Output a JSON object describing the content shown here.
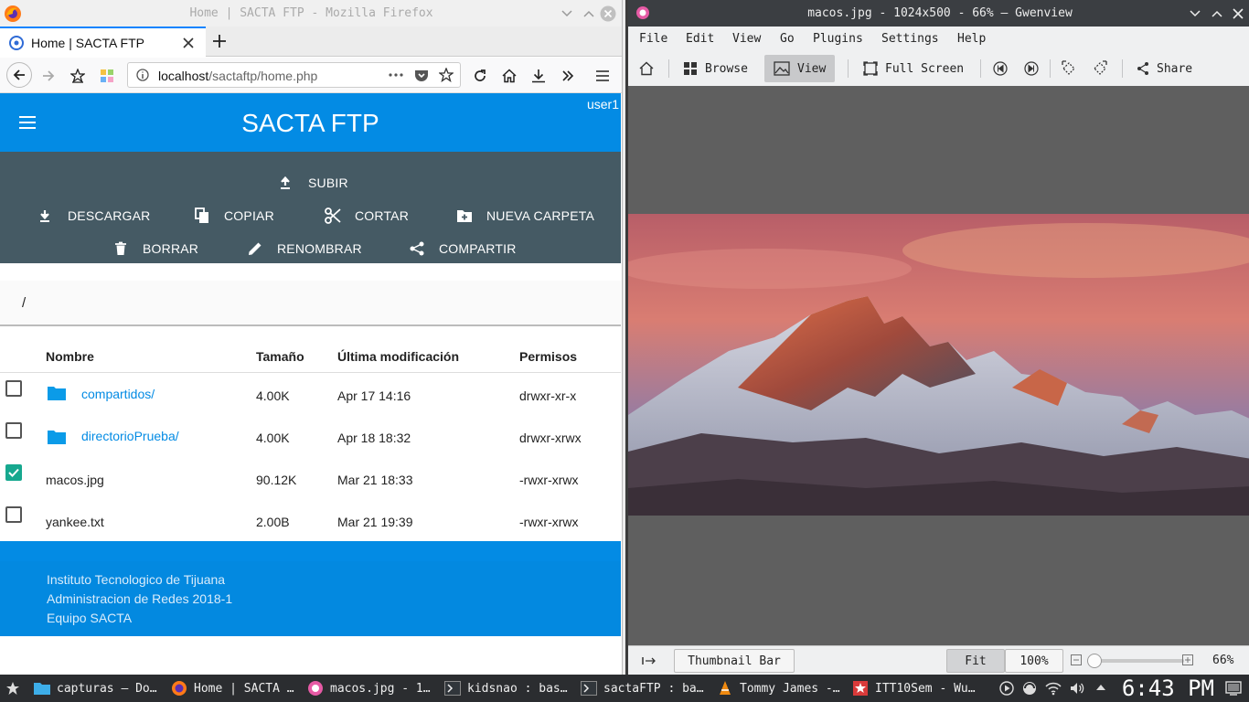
{
  "firefox": {
    "window_title": "Home | SACTA FTP - Mozilla Firefox",
    "tab_title": "Home | SACTA FTP",
    "url_host": "localhost",
    "url_path": "/sactaftp/home.php"
  },
  "app": {
    "title": "SACTA FTP",
    "user": "user1",
    "actions": {
      "upload": "SUBIR",
      "download": "DESCARGAR",
      "copy": "COPIAR",
      "cut": "CORTAR",
      "new_folder": "NUEVA CARPETA",
      "delete": "BORRAR",
      "rename": "RENOMBRAR",
      "share": "COMPARTIR"
    },
    "path": "/",
    "table": {
      "headers": {
        "name": "Nombre",
        "size": "Tamaño",
        "modified": "Última modificación",
        "permissions": "Permisos"
      },
      "rows": [
        {
          "name": "compartidos/",
          "size": "4.00K",
          "modified": "Apr 17 14:16",
          "perms": "drwxr-xr-x",
          "checked": false,
          "folder": true
        },
        {
          "name": "directorioPrueba/",
          "size": "4.00K",
          "modified": "Apr 18 18:32",
          "perms": "drwxr-xrwx",
          "checked": false,
          "folder": true
        },
        {
          "name": "macos.jpg",
          "size": "90.12K",
          "modified": "Mar 21 18:33",
          "perms": "-rwxr-xrwx",
          "checked": true,
          "folder": false
        },
        {
          "name": "yankee.txt",
          "size": "2.00B",
          "modified": "Mar 21 19:39",
          "perms": "-rwxr-xrwx",
          "checked": false,
          "folder": false
        }
      ]
    },
    "footer": {
      "line1": "Instituto Tecnologico de Tijuana",
      "line2": "Administracion de Redes 2018-1",
      "line3": "Equipo SACTA"
    }
  },
  "gwenview": {
    "window_title": "macos.jpg - 1024x500 - 66% — Gwenview",
    "menu": [
      "File",
      "Edit",
      "View",
      "Go",
      "Plugins",
      "Settings",
      "Help"
    ],
    "toolbar": {
      "browse": "Browse",
      "view": "View",
      "full_screen": "Full Screen",
      "share": "Share"
    },
    "status": {
      "thumbnail_bar": "Thumbnail Bar",
      "fit": "Fit",
      "hundred": "100%",
      "zoom": "66%"
    },
    "zoom_slider_fraction": 0.0
  },
  "taskbar": {
    "tasks": [
      "capturas — Do…",
      "Home | SACTA …",
      "macos.jpg - 1…",
      "kidsnao : bas…",
      "sactaFTP : ba…",
      "Tommy James -…",
      "ITT10Sem - Wu…"
    ],
    "clock": "6:43 PM"
  },
  "colors": {
    "primary_blue": "#038be4",
    "action_bar": "#455a64",
    "checkbox_checked": "#17a88f"
  }
}
